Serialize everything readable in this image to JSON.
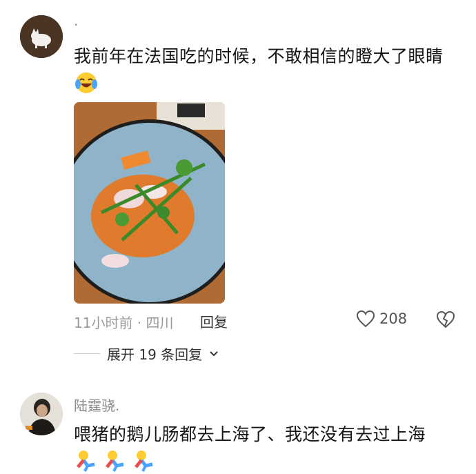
{
  "comments": [
    {
      "username": "·",
      "avatar_icon": "cat-avatar-icon",
      "text": "我前年在法国吃的时候，不敢相信的瞪大了眼睛",
      "emoji": "laughing-crying-face-icon",
      "image": "food-photo-plate",
      "time": "11小时前 · 四川",
      "reply_label": "回复",
      "likes": "208",
      "expand_label": "展开 19 条回复"
    },
    {
      "username": "陆霆骁.",
      "avatar_icon": "person-avatar-icon",
      "text": "喂猪的鹅儿肠都去上海了、我还没有去过上海",
      "emoji": [
        "running-figure-icon",
        "running-figure-icon",
        "running-figure-icon"
      ]
    }
  ],
  "colors": {
    "meta_gray": "#9a9a9a",
    "plate_blue": "#8fb3c8",
    "table_wood": "#b5703a"
  }
}
